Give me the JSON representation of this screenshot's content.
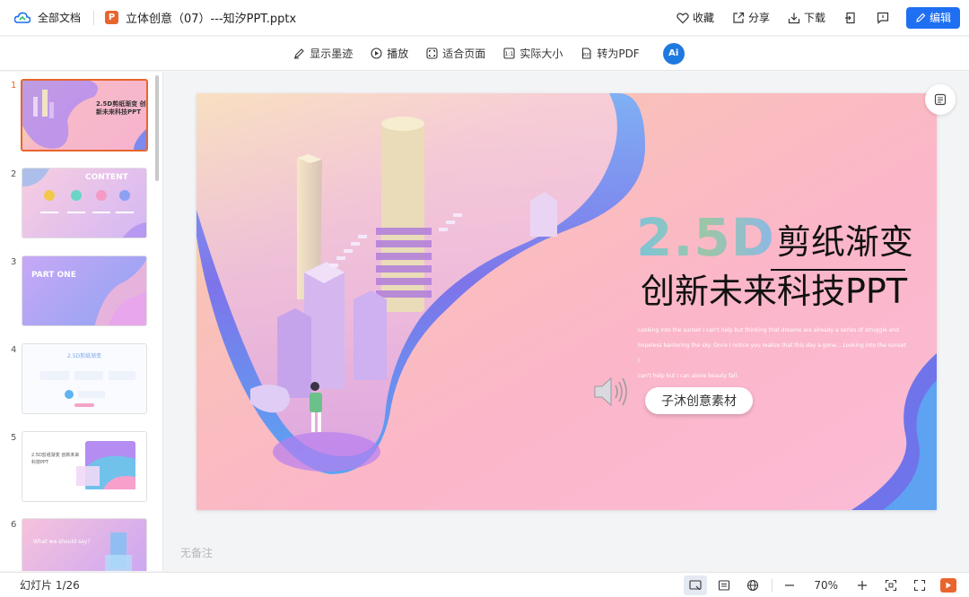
{
  "topbar": {
    "home_label": "全部文档",
    "app_letter": "P",
    "doc_title": "立体创意（07）---知汐PPT.pptx",
    "favorite_label": "收藏",
    "share_label": "分享",
    "download_label": "下载",
    "edit_label": "编辑"
  },
  "toolbar": {
    "show_ink": "显示墨迹",
    "play": "播放",
    "fit_page": "适合页面",
    "actual_size": "实际大小",
    "to_pdf": "转为PDF",
    "ai_label": "Ai"
  },
  "sidebar": {
    "thumbnails": [
      {
        "num": "1",
        "text": "2.5D剪纸渐变 创新未来科技PPT"
      },
      {
        "num": "2",
        "text": "CONTENT"
      },
      {
        "num": "3",
        "text": "PART ONE"
      },
      {
        "num": "4",
        "text": "2.5D剪纸渐变"
      },
      {
        "num": "5",
        "text": "2.5D剪纸渐变 创新未来科技PPT"
      },
      {
        "num": "6",
        "text": "What we should say?"
      }
    ]
  },
  "slide": {
    "title_en": "2.5D",
    "title_cn_1": "剪纸渐变",
    "title_cn_2": "创新未来科技PPT",
    "body_lines": [
      "Looking into the sunset I can't help but thinking that dreams are already a series of struggle and",
      "hopeless bantering the sky. Once I notice you realize that this day a gone... Looking into the sunset I",
      "can't help but I can alone beauty fall."
    ],
    "pill_label": "子沐创意素材",
    "notes_placeholder": "无备注"
  },
  "statusbar": {
    "slide_count": "幻灯片 1/26",
    "zoom": "70%"
  },
  "colors": {
    "accent": "#1f6ff2",
    "ppt_orange": "#e8652e"
  }
}
